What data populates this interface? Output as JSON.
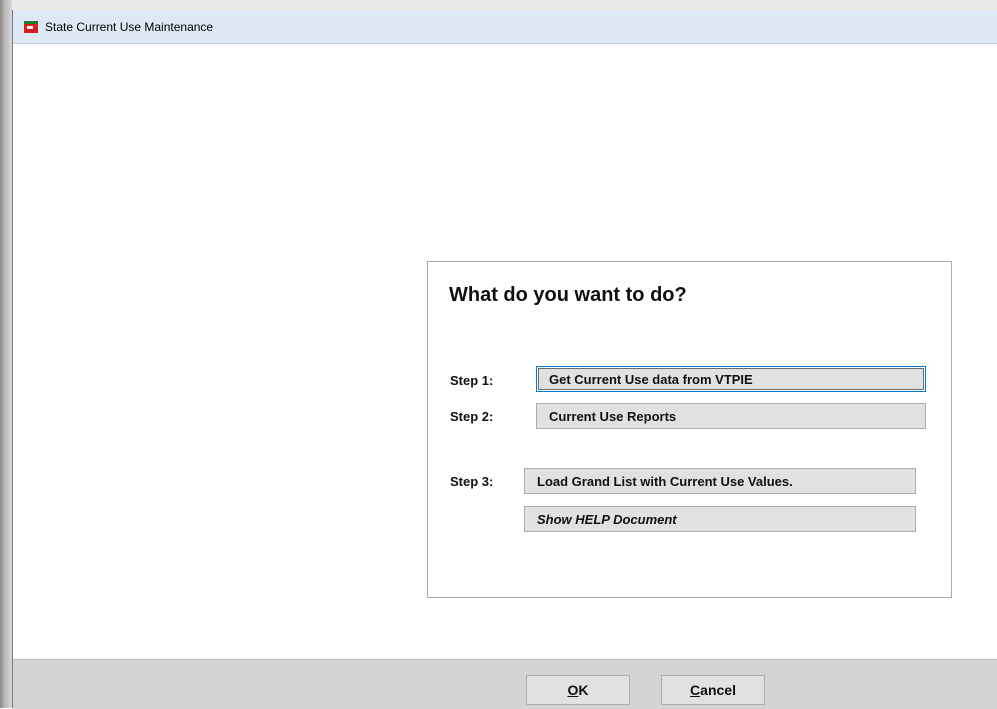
{
  "window": {
    "title": "State Current Use Maintenance",
    "icon": "app-icon"
  },
  "panel": {
    "heading": "What do you want to do?",
    "steps": [
      {
        "label": "Step 1:",
        "button": "Get Current Use data from VTPIE",
        "focused": true
      },
      {
        "label": "Step 2:",
        "button": "Current Use Reports"
      },
      {
        "label": "Step 3:",
        "button": "Load Grand List with Current Use Values."
      },
      {
        "label": "",
        "button": "Show HELP Document"
      }
    ]
  },
  "footer": {
    "ok": {
      "mnemonic": "O",
      "rest": "K"
    },
    "cancel": {
      "mnemonic": "C",
      "rest": "ancel"
    }
  },
  "colors": {
    "titlebar": "#dfe9f5",
    "footer": "#d4d4d4",
    "button": "#e1e1e1",
    "focus": "#0078d7"
  }
}
